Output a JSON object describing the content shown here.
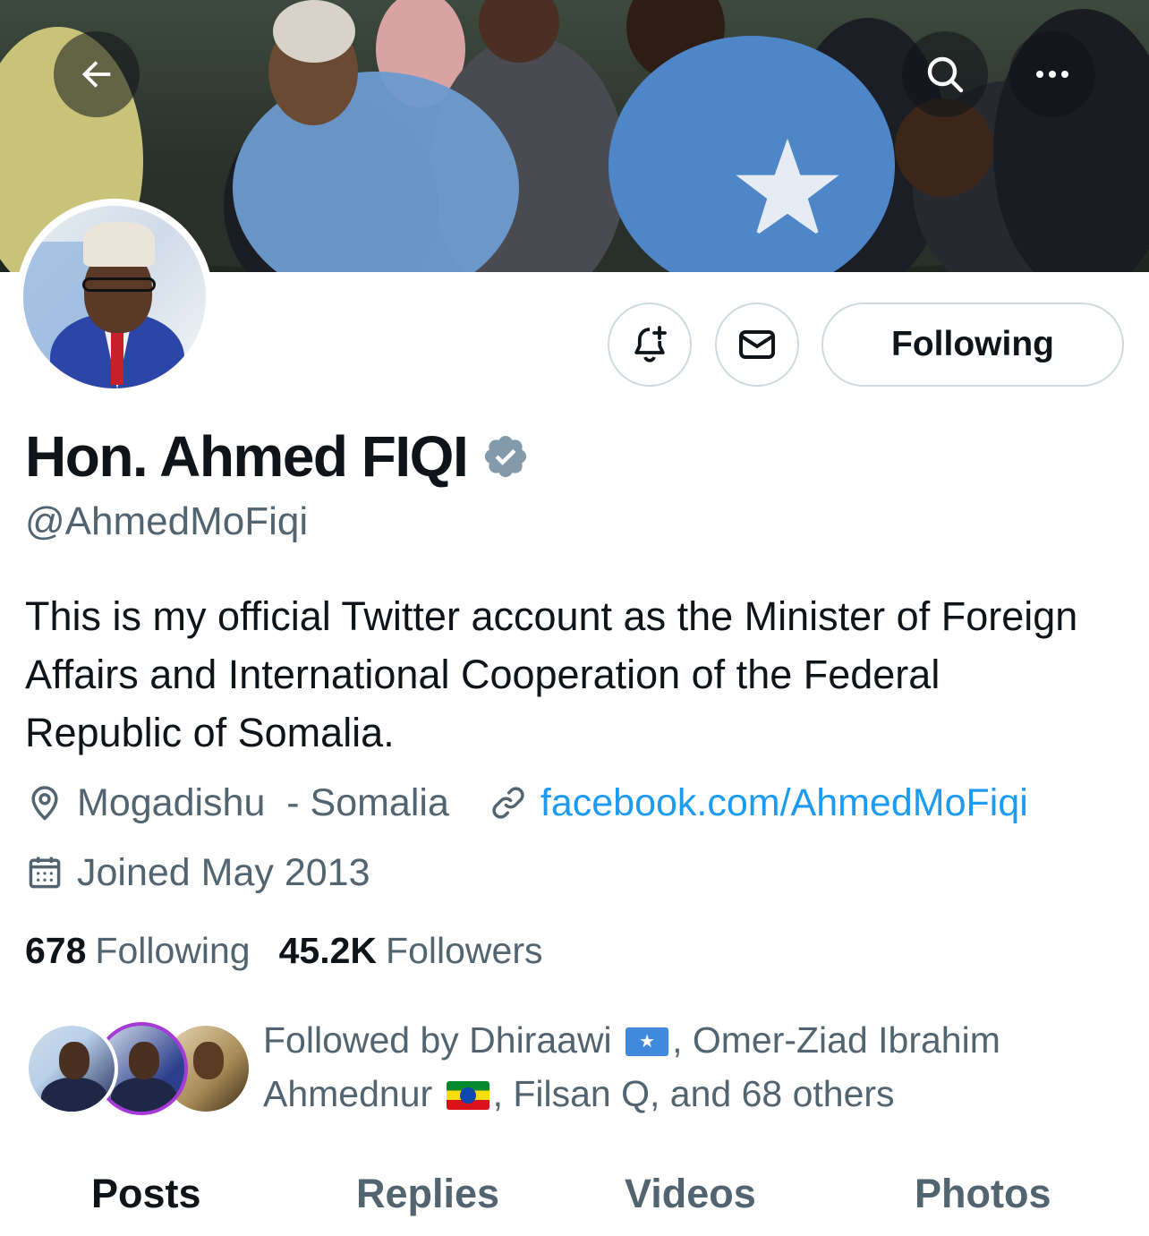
{
  "header": {
    "back_icon": "arrow-left-icon",
    "search_icon": "search-icon",
    "more_icon": "more-dots-icon"
  },
  "actions": {
    "notify_icon": "bell-plus-icon",
    "message_icon": "envelope-icon",
    "follow_label": "Following"
  },
  "profile": {
    "display_name": "Hon. Ahmed FIQI",
    "verified_icon": "verified-badge-icon",
    "handle": "@AhmedMoFiqi",
    "bio": "This is my official Twitter account as the Minister of Foreign Affairs and International Cooperation of the Federal Republic of Somalia.",
    "location": "Mogadishu  - Somalia",
    "website": "facebook.com/AhmedMoFiqi",
    "joined": "Joined May 2013"
  },
  "stats": {
    "following_count": "678",
    "following_label": "Following",
    "followers_count": "45.2K",
    "followers_label": "Followers"
  },
  "followed_by": {
    "prefix": "Followed by Dhiraawi",
    "middle": ", Omer-Ziad Ibrahim Ahmednur",
    "suffix": ", Filsan Q, and 68 others"
  },
  "tabs": [
    "Posts",
    "Replies",
    "Videos",
    "Photos"
  ],
  "colors": {
    "accent": "#1d9bf0",
    "text_primary": "#0f1419",
    "text_secondary": "#536471",
    "border": "#cfd9de",
    "verified": "#829aab"
  }
}
